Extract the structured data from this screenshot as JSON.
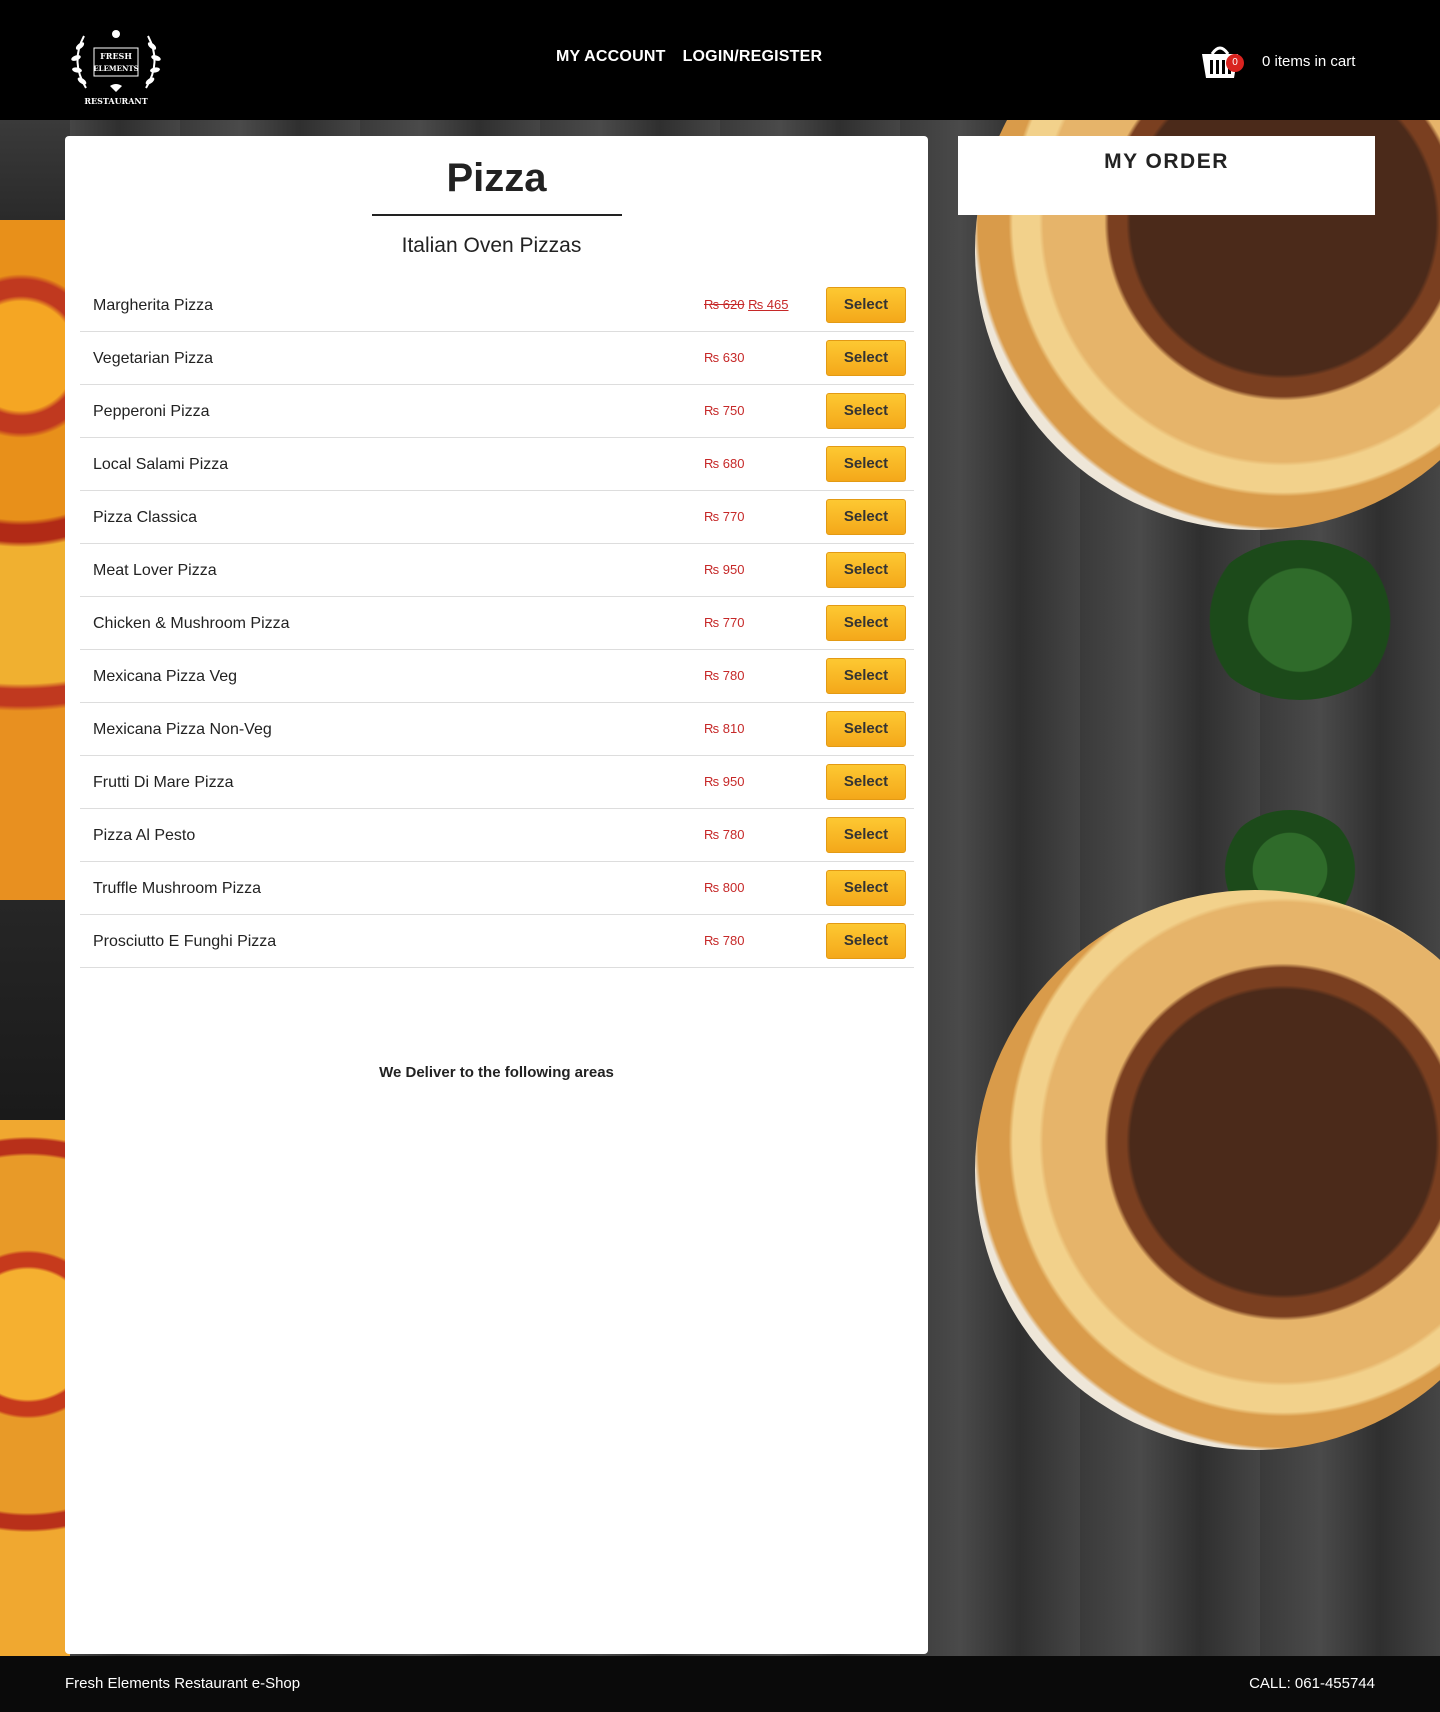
{
  "header": {
    "logo_alt": "Fresh Elements Restaurant",
    "logo_top": "FRESH",
    "logo_mid": "ELEMENTS",
    "logo_bottom": "RESTAURANT",
    "nav": [
      {
        "label": "MY ACCOUNT"
      },
      {
        "label": "LOGIN/REGISTER"
      }
    ],
    "cart_count": "0",
    "cart_text": "0 items in cart"
  },
  "main": {
    "title": "Pizza",
    "subtitle": "Italian Oven Pizzas",
    "select_label": "Select",
    "items": [
      {
        "name": "Margherita Pizza",
        "old_price": "₨ 620",
        "price": "₨ 465"
      },
      {
        "name": "Vegetarian Pizza",
        "price": "₨ 630"
      },
      {
        "name": "Pepperoni Pizza",
        "price": "₨ 750"
      },
      {
        "name": "Local Salami Pizza",
        "price": "₨ 680"
      },
      {
        "name": "Pizza Classica",
        "price": "₨ 770"
      },
      {
        "name": "Meat Lover Pizza",
        "price": "₨ 950"
      },
      {
        "name": "Chicken & Mushroom Pizza",
        "price": "₨ 770"
      },
      {
        "name": "Mexicana Pizza Veg",
        "price": "₨ 780"
      },
      {
        "name": "Mexicana Pizza Non-Veg",
        "price": "₨ 810"
      },
      {
        "name": "Frutti Di Mare Pizza",
        "price": "₨ 950"
      },
      {
        "name": "Pizza Al Pesto",
        "price": "₨ 780"
      },
      {
        "name": "Truffle Mushroom Pizza",
        "price": "₨ 800"
      },
      {
        "name": "Prosciutto E Funghi Pizza",
        "price": "₨ 780"
      }
    ],
    "deliver_text": "We Deliver to the following areas"
  },
  "sidebar": {
    "order_title": "MY ORDER"
  },
  "footer": {
    "left": "Fresh Elements Restaurant e-Shop",
    "right": "CALL: 061-455744"
  },
  "colors": {
    "header_bg": "#000000",
    "price": "#c62828",
    "select_button": "#f8b420",
    "cart_badge": "#d9231f"
  }
}
